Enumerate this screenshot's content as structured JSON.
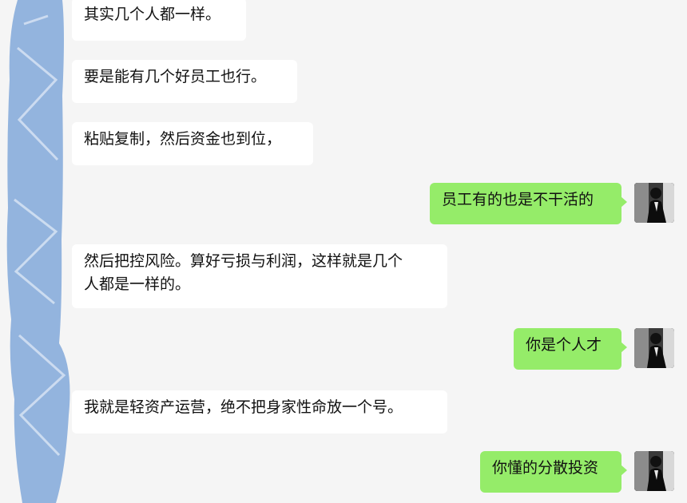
{
  "messages": [
    {
      "side": "in",
      "text": "其实几个人都一样。"
    },
    {
      "side": "in",
      "text": "要是能有几个好员工也行。"
    },
    {
      "side": "in",
      "text": "粘贴复制，然后资金也到位，"
    },
    {
      "side": "out",
      "text": "员工有的也是不干活的"
    },
    {
      "side": "in",
      "text": "然后把控风险。算好亏损与利润，这样就是几个\n人都是一样的。"
    },
    {
      "side": "out",
      "text": "你是个人才"
    },
    {
      "side": "in",
      "text": "我就是轻资产运营，绝不把身家性命放一个号。"
    },
    {
      "side": "out",
      "text": "你懂的分散投资"
    }
  ],
  "colors": {
    "background": "#f5f5f5",
    "incoming_bubble": "#ffffff",
    "outgoing_bubble": "#95ec69",
    "redaction": "#93b4de"
  },
  "icons": {
    "avatar": "user-avatar-photo"
  }
}
